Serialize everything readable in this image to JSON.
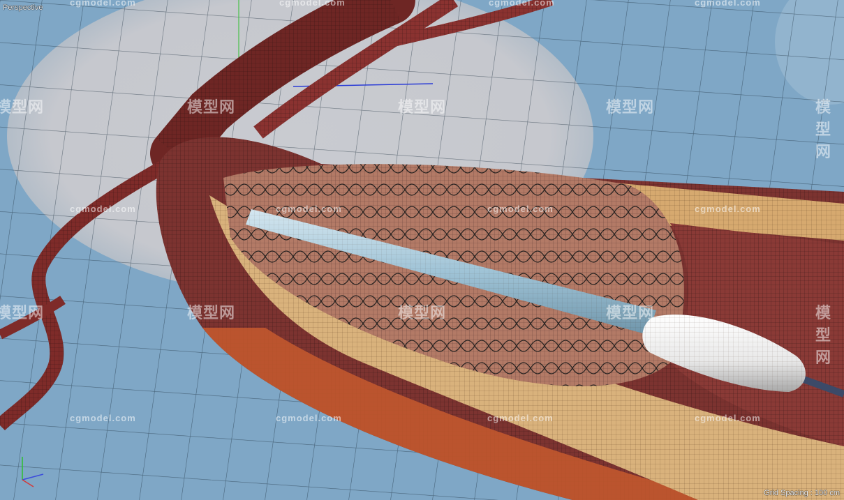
{
  "viewport": {
    "view_label": "Perspective",
    "grid_spacing": "Grid Spacing : 100 cm",
    "icon": "perspective-viewport",
    "background_color": "#7fa7c6",
    "highlight_color": "#c5c9d0",
    "grid_color": "#1a2b3a"
  },
  "model": {
    "vessel_color": "#7a2c2a",
    "plaque_color": "#d8b07a",
    "stent_color": "#2a2a2a",
    "catheter_color": "#a9c9db",
    "balloon_tip_color": "#f2f2f2"
  },
  "watermarks": {
    "text": "cgmodel.com",
    "logo_text": "模型网"
  }
}
